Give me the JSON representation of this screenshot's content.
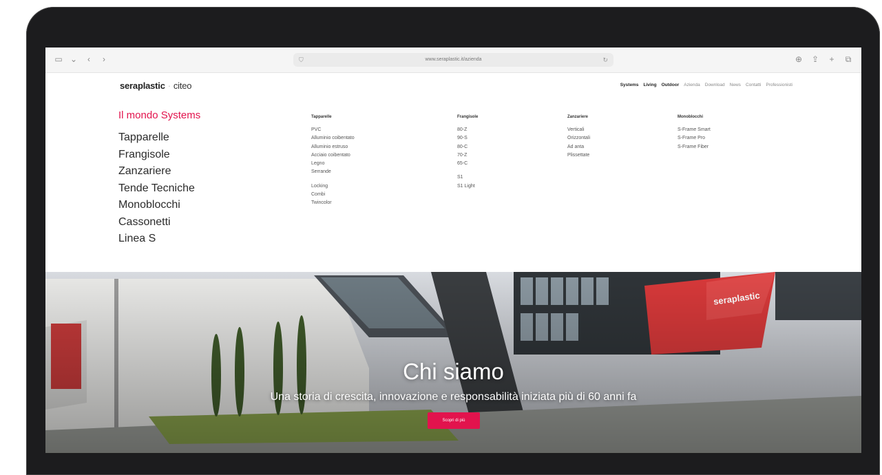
{
  "browser": {
    "url": "www.seraplastic.it/azienda",
    "icons": [
      "sidebar-icon",
      "chevron-down-icon",
      "back-icon",
      "forward-icon",
      "shield-icon",
      "reload-icon",
      "download-icon",
      "share-icon",
      "new-tab-icon",
      "tabs-overview-icon"
    ]
  },
  "header": {
    "logo_primary": "seraplastic",
    "logo_separator": "·",
    "logo_secondary": "citeo",
    "nav": [
      {
        "label": "Systems",
        "bold": true
      },
      {
        "label": "Living",
        "bold": true
      },
      {
        "label": "Outdoor",
        "bold": true
      },
      {
        "label": "Azienda",
        "bold": false
      },
      {
        "label": "Download",
        "bold": false
      },
      {
        "label": "News",
        "bold": false
      },
      {
        "label": "Contatti",
        "bold": false
      },
      {
        "label": "Professionisti",
        "bold": false
      }
    ]
  },
  "mega_menu": {
    "title": "Il mondo Systems",
    "main_items": [
      "Tapparelle",
      "Frangisole",
      "Zanzariere",
      "Tende Tecniche",
      "Monoblocchi",
      "Cassonetti",
      "Linea S"
    ],
    "columns": [
      {
        "heading": "Tapparelle",
        "items": [
          "PVC",
          "Alluminio coibentato",
          "Alluminio estruso",
          "Acciaio coibentato",
          "Legno",
          "Serrande",
          "Locking",
          "Combi",
          "Twincolor"
        ]
      },
      {
        "heading": "Frangisole",
        "items": [
          "80-Z",
          "90-S",
          "80-C",
          "70-Z",
          "65-C",
          "S1",
          "S1 Light"
        ]
      },
      {
        "heading": "Zanzariere",
        "items": [
          "Verticali",
          "Orizzontali",
          "Ad anta",
          "Plissettate"
        ]
      },
      {
        "heading": "Monoblocchi",
        "items": [
          "S-Frame Smart",
          "S-Frame Pro",
          "S-Frame Fiber"
        ]
      }
    ]
  },
  "hero": {
    "title": "Chi siamo",
    "subtitle": "Una storia di crescita, innovazione e responsabilità iniziata più di 60 anni fa",
    "cta": "Scopri di più",
    "building_sign": "seraplastic"
  },
  "colors": {
    "accent": "#e2134d",
    "bezel": "#1c1c1e",
    "text_dark": "#2b2b2b"
  }
}
